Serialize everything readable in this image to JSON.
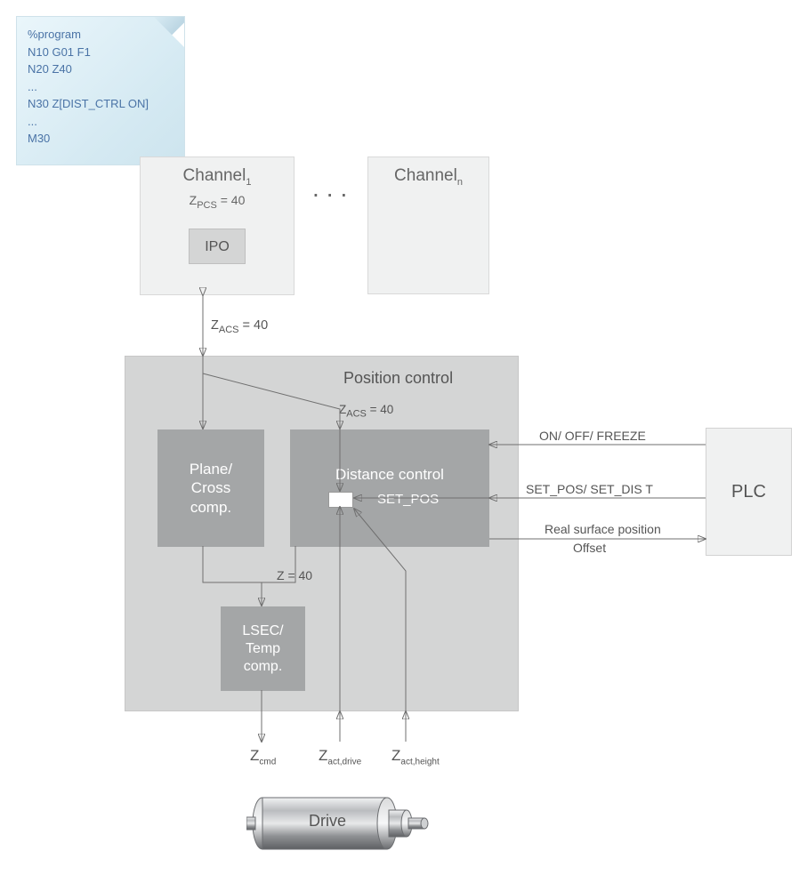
{
  "note": {
    "line1": "%program",
    "line2": "N10 G01 F1",
    "line3": "N20 Z40",
    "line4": "...",
    "line5": "N30 Z[DIST_CTRL ON]",
    "line6": "...",
    "line7": "M30"
  },
  "channel1": {
    "label": "Channel",
    "sub": "1",
    "zpcs_prefix": "Z",
    "zpcs_sub": "PCS",
    "zpcs_eq": " = 40",
    "ipo": "IPO"
  },
  "channeln": {
    "label": "Channel",
    "sub": "n"
  },
  "ellipsis": "...",
  "zacs_outer_prefix": "Z",
  "zacs_outer_sub": "ACS",
  "zacs_outer_eq": " = 40",
  "posctrl": {
    "title": "Position control",
    "zacs_inner_prefix": "Z",
    "zacs_inner_sub": "ACS",
    "zacs_inner_eq": " = 40",
    "plane_l1": "Plane/",
    "plane_l2": "Cross",
    "plane_l3": "comp.",
    "dist": "Distance control",
    "setpos": "SET_POS",
    "z40": "Z = 40",
    "lsec_l1": "LSEC/",
    "lsec_l2": "Temp",
    "lsec_l3": "comp."
  },
  "plc": {
    "label": "PLC",
    "line1": "ON/ OFF/ FREEZE",
    "line2": "SET_POS/ SET_DIS   T",
    "line3": "Real surface position",
    "line4": "Offset"
  },
  "bottom": {
    "zcmd_pre": "Z",
    "zcmd_sub": "cmd",
    "zdrv_pre": "Z",
    "zdrv_sub": "act,drive",
    "zhgt_pre": "Z",
    "zhgt_sub": "act,height"
  },
  "drive": "Drive"
}
